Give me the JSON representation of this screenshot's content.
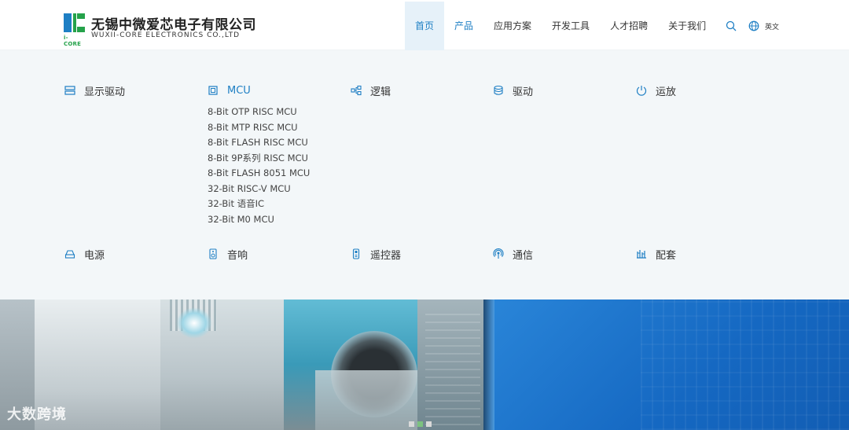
{
  "brand": {
    "mark_tag": "i-CORE",
    "name_cn": "无锡中微爱芯电子有限公司",
    "name_en": "WUXII-CORE ELECTRONICS CO.,LTD",
    "colors": {
      "blue": "#1e7fc4",
      "green": "#25a24a"
    }
  },
  "nav": {
    "items": [
      {
        "label": "首页",
        "state": "active"
      },
      {
        "label": "产品",
        "state": "hover"
      },
      {
        "label": "应用方案",
        "state": "normal"
      },
      {
        "label": "开发工具",
        "state": "normal"
      },
      {
        "label": "人才招聘",
        "state": "normal"
      },
      {
        "label": "关于我们",
        "state": "normal"
      }
    ],
    "search_icon": "search-icon",
    "lang_icon": "globe-icon",
    "lang_label": "英文"
  },
  "mega_menu": {
    "categories": [
      {
        "label": "显示驱动",
        "icon": "display-driver-icon"
      },
      {
        "label": "MCU",
        "icon": "chip-icon",
        "active": true
      },
      {
        "label": "逻辑",
        "icon": "logic-icon"
      },
      {
        "label": "驱动",
        "icon": "driver-icon"
      },
      {
        "label": "运放",
        "icon": "op-amp-icon"
      },
      {
        "label": "电源",
        "icon": "power-icon"
      },
      {
        "label": "音响",
        "icon": "speaker-icon"
      },
      {
        "label": "遥控器",
        "icon": "remote-icon"
      },
      {
        "label": "通信",
        "icon": "signal-icon"
      },
      {
        "label": "配套",
        "icon": "accessory-icon"
      }
    ],
    "mcu_items": [
      "8-Bit OTP RISC MCU",
      "8-Bit MTP RISC MCU",
      "8-Bit FLASH RISC MCU",
      "8-Bit 9P系列 RISC MCU",
      "8-Bit FLASH 8051 MCU",
      "32-Bit RISC-V MCU",
      "32-Bit 语音IC",
      "32-Bit M0 MCU"
    ],
    "accent_color": "#1e7fc4"
  },
  "banner": {
    "slides": 3,
    "active_slide": 2,
    "watermark": "大数跨境"
  }
}
